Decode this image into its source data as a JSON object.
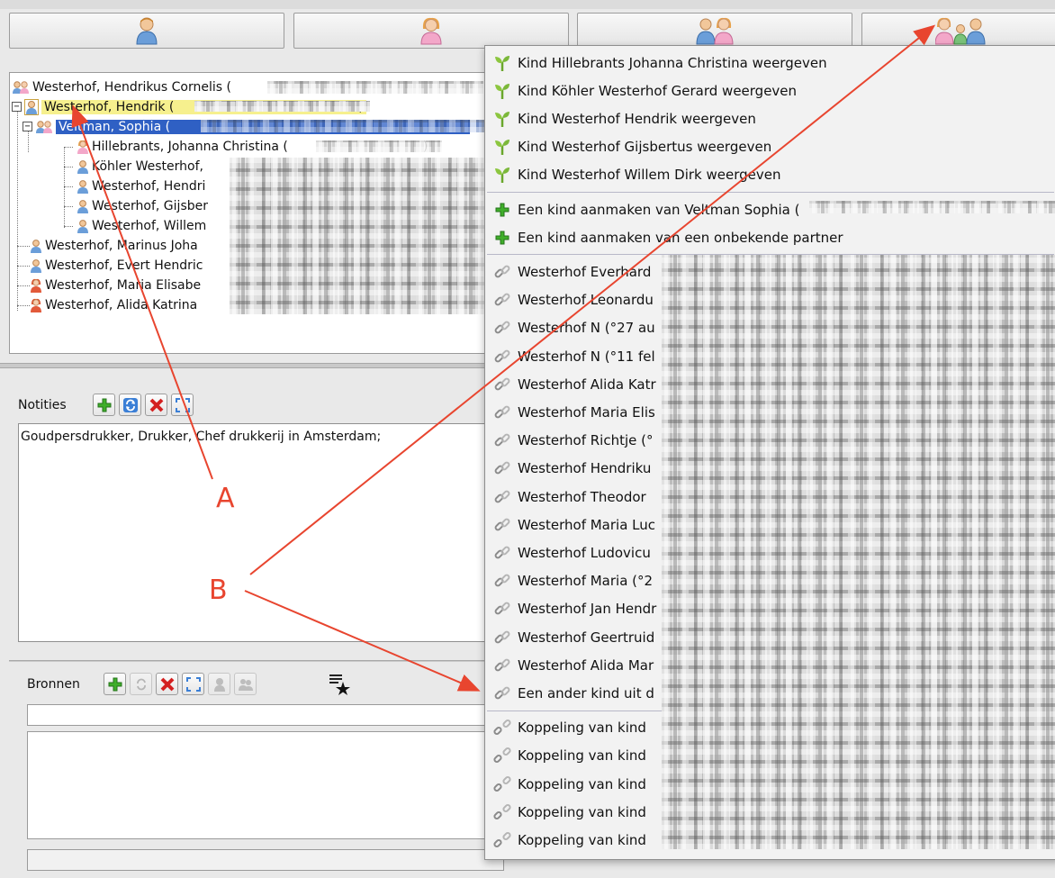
{
  "toolbar": {
    "buttons": [
      {
        "icon": "man-icon"
      },
      {
        "icon": "woman-icon"
      },
      {
        "icon": "couple-icon"
      },
      {
        "icon": "family-icon"
      }
    ]
  },
  "tree": {
    "rows": [
      {
        "label": "Westerhof, Hendrikus Cornelis (",
        "icon": "couple-small-icon"
      },
      {
        "label": "Westerhof, Hendrik (",
        "icon": "man-small-icon",
        "tail": ")"
      },
      {
        "label": "Veltman, Sophia (",
        "icon": "couple-small-icon"
      },
      {
        "label": "Hillebrants, Johanna Christina (",
        "icon": "woman-small-icon",
        "tail": ")"
      },
      {
        "label": "Köhler Westerhof,",
        "icon": "man-small-icon"
      },
      {
        "label": "Westerhof, Hendri",
        "icon": "man-small-icon"
      },
      {
        "label": "Westerhof, Gijsber",
        "icon": "man-small-icon"
      },
      {
        "label": "Westerhof, Willem",
        "icon": "man-small-icon"
      },
      {
        "label": "Westerhof, Marinus Joha",
        "icon": "man-small-icon"
      },
      {
        "label": "Westerhof, Evert Hendric",
        "icon": "man-small-icon"
      },
      {
        "label": "Westerhof, Maria Elisabe",
        "icon": "woman-small-icon"
      },
      {
        "label": "Westerhof, Alida Katrina",
        "icon": "woman-small-icon"
      }
    ]
  },
  "notes": {
    "label": "Notities",
    "text": "Goudpersdrukker, Drukker, Chef drukkerij in Amsterdam;"
  },
  "sources": {
    "label": "Bronnen"
  },
  "menu": {
    "show_children": [
      "Kind Hillebrants Johanna Christina weergeven",
      "Kind Köhler Westerhof Gerard weergeven",
      "Kind Westerhof Hendrik weergeven",
      "Kind Westerhof Gijsbertus weergeven",
      "Kind Westerhof Willem Dirk weergeven"
    ],
    "create_children": [
      "Een kind aanmaken van Veltman Sophia (",
      "Een kind aanmaken van een onbekende partner"
    ],
    "link_children": [
      "Westerhof Everhard",
      "Westerhof Leonardu",
      "Westerhof N (°27 au",
      "Westerhof N (°11 fel",
      "Westerhof Alida Katr",
      "Westerhof Maria Elis",
      "Westerhof Richtje (°",
      "Westerhof Hendriku",
      "Westerhof Theodor",
      "Westerhof Maria Luc",
      "Westerhof Ludovicu",
      "Westerhof Maria (°2",
      "Westerhof Jan Hendr",
      "Westerhof Geertruid",
      "Westerhof Alida Mar",
      "Een ander kind uit d"
    ],
    "unlink_children": [
      "Koppeling van kind",
      "Koppeling van kind",
      "Koppeling van kind",
      "Koppeling van kind",
      "Koppeling van kind"
    ]
  },
  "annotations": {
    "a": "A",
    "b": "B",
    "color": "#e8452f"
  }
}
